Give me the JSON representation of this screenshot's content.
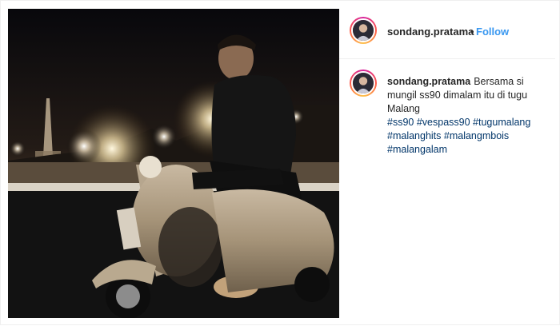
{
  "post": {
    "username": "sondang.pratama",
    "separator": "•",
    "follow_label": "Follow",
    "caption": {
      "username": "sondang.pratama",
      "text": "Bersama si mungil ss90 dimalam itu di tugu Malang",
      "hashtags": [
        "#ss90",
        "#vespass90",
        "#tugumalang",
        "#malanghits",
        "#malangmbois",
        "#malangalam"
      ]
    },
    "photo_icon": "photo",
    "avatar_icon": "profile-avatar"
  },
  "colors": {
    "link": "#003569",
    "follow": "#3897f0",
    "text": "#262626"
  }
}
